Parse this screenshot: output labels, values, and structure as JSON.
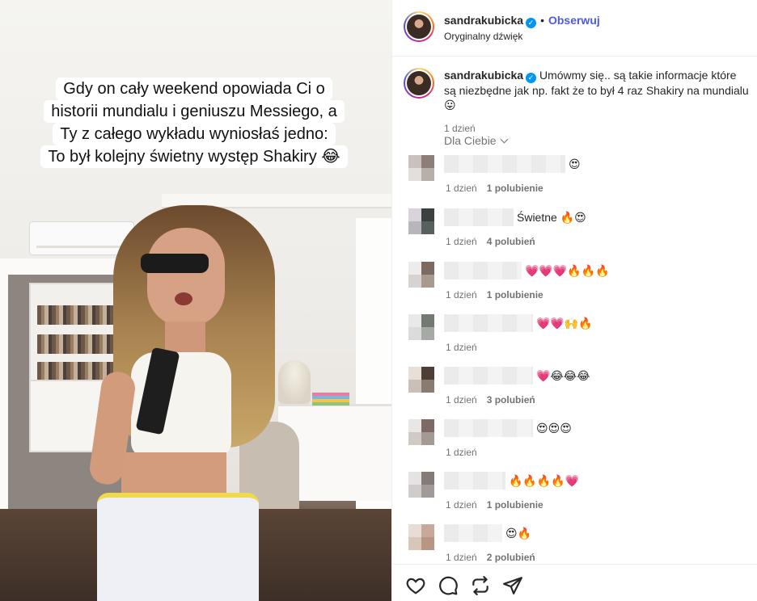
{
  "video": {
    "caption_lines": [
      "Gdy on cały weekend opowiada Ci o",
      "historii mundialu i geniuszu Messiego, a",
      "Ty z całego wykładu wyniosłaś jedno:",
      "To był kolejny świetny występ Shakiry 😂"
    ]
  },
  "header": {
    "username": "sandrakubicka",
    "separator": "•",
    "follow_label": "Obserwuj",
    "audio_label": "Oryginalny dźwięk"
  },
  "post_caption": {
    "username": "sandrakubicka",
    "text": "Umówmy się.. są takie informacje które są niezbędne jak np. fakt że to był 4 raz Shakiry na mundialu 😛",
    "time": "1 dzień"
  },
  "comments_filter": "Dla Ciebie",
  "comments": [
    {
      "text": "😍",
      "time": "1 dzień",
      "likes": "1 polubienie"
    },
    {
      "text": "Świetne 🔥😍",
      "time": "1 dzień",
      "likes": "4 polubień"
    },
    {
      "text": "💗💗💗🔥🔥🔥",
      "time": "1 dzień",
      "likes": "1 polubienie"
    },
    {
      "text": "💗💗🙌🔥",
      "time": "1 dzień",
      "likes": ""
    },
    {
      "text": "💗😂😂😂",
      "time": "1 dzień",
      "likes": "3 polubień"
    },
    {
      "text": "😍😍😍",
      "time": "1 dzień",
      "likes": ""
    },
    {
      "text": "🔥🔥🔥🔥💗",
      "time": "1 dzień",
      "likes": "1 polubienie"
    },
    {
      "text": "😍🔥",
      "time": "1 dzień",
      "likes": "2 polubień"
    }
  ],
  "actions": {
    "like_icon": "heart-icon",
    "comment_icon": "comment-bubble-icon",
    "repost_icon": "repost-icon",
    "share_icon": "paper-plane-icon"
  },
  "colors": {
    "follow_blue": "#4f5bd5",
    "verified_blue": "#0095f6",
    "meta_gray": "#737373",
    "divider": "#efefef"
  }
}
